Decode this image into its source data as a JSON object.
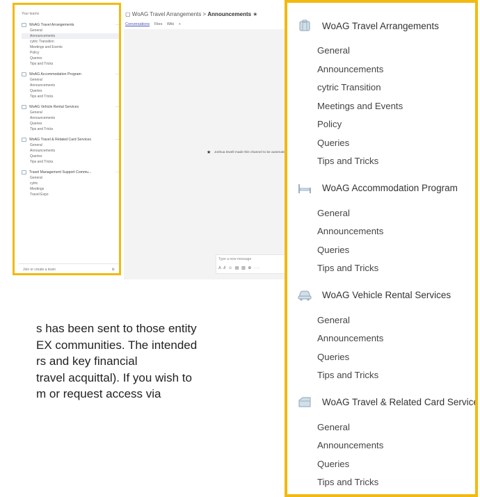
{
  "mini_screenshot": {
    "sidebar_heading": "Your teams",
    "teams": [
      {
        "name": "WoAG Travel Arrangements",
        "channels": [
          "General",
          "Announcements",
          "cytric Transition",
          "Meetings and Events",
          "Policy",
          "Queries",
          "Tips and Tricks"
        ],
        "active_index": 1
      },
      {
        "name": "WoAG Accommodation Program",
        "channels": [
          "General",
          "Announcements",
          "Queries",
          "Tips and Tricks"
        ],
        "active_index": -1
      },
      {
        "name": "WoAG Vehicle Rental Services",
        "channels": [
          "General",
          "Announcements",
          "Queries",
          "Tips and Tricks"
        ],
        "active_index": -1
      },
      {
        "name": "WoAG Travel & Related Card Services",
        "channels": [
          "General",
          "Announcements",
          "Queries",
          "Tips and Tricks"
        ],
        "active_index": -1
      },
      {
        "name": "Travel Management Support Commu...",
        "channels": [
          "General",
          "cytric",
          "Meetings",
          "Travel Expo"
        ],
        "active_index": -1
      }
    ],
    "more_glyph": "···",
    "join_label": "Join or create a team",
    "header_team": "WoAG Travel Arrangements",
    "header_sep": ">",
    "header_channel": "Announcements",
    "tabs": [
      "Conversations",
      "Files",
      "Wiki",
      "+"
    ],
    "post_text": "Joshua Dwell made this channel to be automatic...",
    "side_letter": "Te",
    "compose_placeholder": "Type a new message",
    "compose_tools": "A  ∂  ☺  ▤  ▧  ⊕  ···"
  },
  "body_text": {
    "lines": [
      "s has been sent to those entity",
      "EX communities. The intended",
      "rs and key financial",
      " travel acquittal). If you wish to",
      "m or request access via"
    ]
  },
  "zoom_panel": {
    "teams": [
      {
        "name": "WoAG Travel Arrangements",
        "icon": "suitcase-icon",
        "channels": [
          "General",
          "Announcements",
          "cytric Transition",
          "Meetings and Events",
          "Policy",
          "Queries",
          "Tips and Tricks"
        ]
      },
      {
        "name": "WoAG Accommodation Program",
        "icon": "bed-icon",
        "channels": [
          "General",
          "Announcements",
          "Queries",
          "Tips and Tricks"
        ]
      },
      {
        "name": "WoAG Vehicle Rental Services",
        "icon": "car-icon",
        "channels": [
          "General",
          "Announcements",
          "Queries",
          "Tips and Tricks"
        ]
      },
      {
        "name": "WoAG Travel & Related Card Services",
        "icon": "card-icon",
        "channels": [
          "General",
          "Announcements",
          "Queries",
          "Tips and Tricks"
        ]
      }
    ]
  },
  "colors": {
    "highlight_border": "#f2b90f",
    "icon_stroke": "#9fb0c0",
    "icon_fill": "#cfe0ea"
  }
}
